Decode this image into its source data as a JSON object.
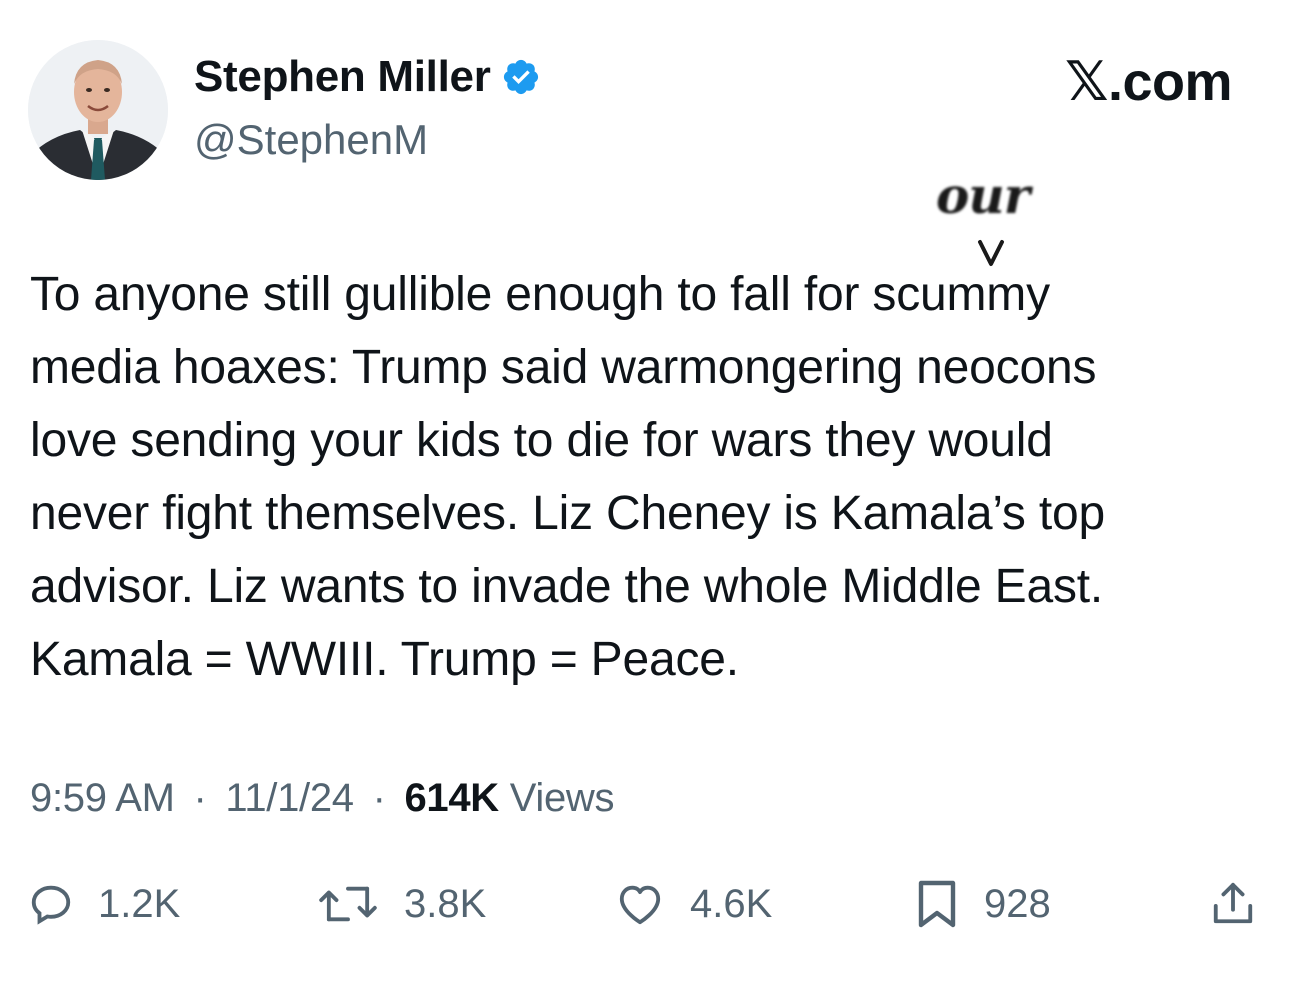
{
  "header": {
    "display_name": "Stephen Miller",
    "handle": "@StephenM",
    "site_brand": "𝕏.com",
    "verified_icon": "verified-badge-icon",
    "verified_color": "#1d9bf0"
  },
  "annotation": {
    "word": "our",
    "caret": "v"
  },
  "tweet": {
    "lines": [
      "To anyone still gullible enough to fall for scummy",
      "media hoaxes: Trump said warmongering neocons",
      "love sending your kids to die for wars they would",
      "never fight themselves. Liz Cheney is Kamala’s top",
      "advisor. Liz wants to invade the whole Middle East.",
      "Kamala = WWIII. Trump = Peace."
    ]
  },
  "meta": {
    "time": "9:59 AM",
    "separator": "·",
    "date": "11/1/24",
    "views_count": "614K",
    "views_label": "Views"
  },
  "actions": {
    "replies": {
      "icon": "reply-icon",
      "count": "1.2K"
    },
    "reposts": {
      "icon": "repost-icon",
      "count": "3.8K"
    },
    "likes": {
      "icon": "heart-icon",
      "count": "4.6K"
    },
    "bookmarks": {
      "icon": "bookmark-icon",
      "count": "928"
    },
    "share": {
      "icon": "share-icon"
    }
  },
  "colors": {
    "text_primary": "#0f1419",
    "text_secondary": "#536471",
    "verified_blue": "#1d9bf0"
  }
}
